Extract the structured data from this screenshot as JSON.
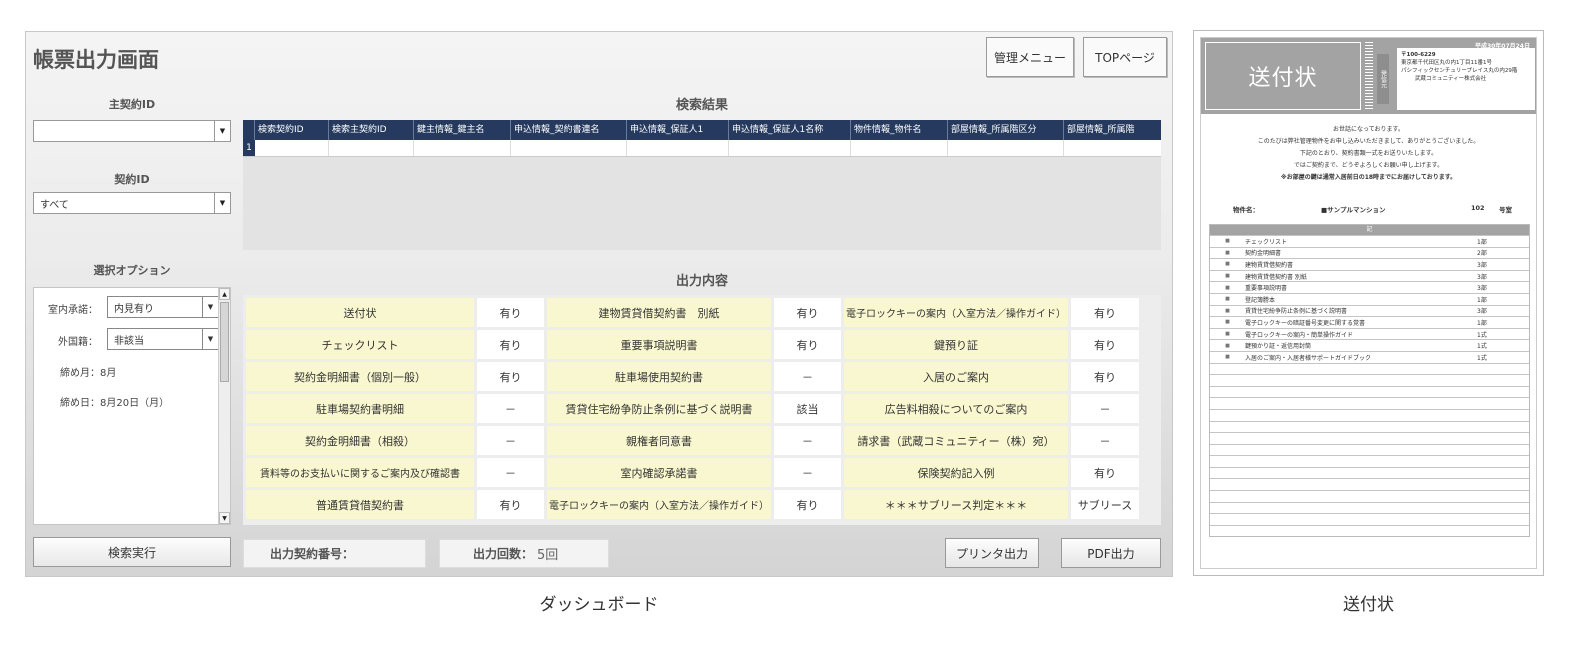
{
  "dashboard": {
    "title": "帳票出力画面",
    "admin_button": "管理メニュー",
    "top_button": "TOPページ",
    "main_contract_label": "主契約ID",
    "main_contract_value": "",
    "contract_label": "契約ID",
    "contract_value": "すべて",
    "options_label": "選択オプション",
    "options": {
      "indoor_label": "室内承諾：",
      "indoor_value": "内見有り",
      "foreign_label": "外国籍：",
      "foreign_value": "非該当",
      "deadline_month": "締め月：8月",
      "deadline_day": "締め日：8月20日（月）"
    },
    "search_button": "検索実行",
    "results_title": "検索結果",
    "results_columns": [
      "検索契約ID",
      "検索主契約ID",
      "鍵主情報_鍵主名",
      "申込情報_契約書連名",
      "申込情報_保証人1",
      "申込情報_保証人1名称",
      "物件情報_物件名",
      "部屋情報_所属階区分",
      "部屋情報_所属階"
    ],
    "results_row_number": "1",
    "output_title": "出力内容",
    "output_items": [
      {
        "name": "送付状",
        "value": "有り"
      },
      {
        "name": "建物賃貸借契約書　別紙",
        "value": "有り"
      },
      {
        "name": "電子ロックキーの案内（入室方法／操作ガイド）",
        "value": "有り"
      },
      {
        "name": "チェックリスト",
        "value": "有り"
      },
      {
        "name": "重要事項説明書",
        "value": "有り"
      },
      {
        "name": "鍵預り証",
        "value": "有り"
      },
      {
        "name": "契約金明細書（個別一般）",
        "value": "有り"
      },
      {
        "name": "駐車場使用契約書",
        "value": "－"
      },
      {
        "name": "入居のご案内",
        "value": "有り"
      },
      {
        "name": "駐車場契約書明細",
        "value": "－"
      },
      {
        "name": "賃貸住宅紛争防止条例に基づく説明書",
        "value": "該当"
      },
      {
        "name": "広告料相殺についてのご案内",
        "value": "－"
      },
      {
        "name": "契約金明細書（相殺）",
        "value": "－"
      },
      {
        "name": "親権者同意書",
        "value": "－"
      },
      {
        "name": "請求書（武蔵コミュニティー（株）宛）",
        "value": "－"
      },
      {
        "name": "賃料等のお支払いに関するご案内及び確認書",
        "value": "－"
      },
      {
        "name": "室内確認承諾書",
        "value": "－"
      },
      {
        "name": "保険契約記入例",
        "value": "有り"
      },
      {
        "name": "普通賃貸借契約書",
        "value": "有り"
      },
      {
        "name": "電子ロックキーの案内（入室方法／操作ガイド）",
        "value": "有り"
      },
      {
        "name": "＊＊＊サブリース判定＊＊＊",
        "value": "サブリース"
      }
    ],
    "output_number_label": "出力契約番号：",
    "output_count_label": "出力回数：",
    "output_count_value": "5回",
    "print_button": "プリンタ出力",
    "pdf_button": "PDF出力"
  },
  "document": {
    "date": "平成30年07月24日",
    "title": "送付状",
    "sender_label": "発信元",
    "zip": "〒100-6229",
    "address_line1": "東京都千代田区丸の内1丁目11番1号",
    "address_line2": "パシフィックセンチュリープレイス丸の内29階",
    "company": "武蔵コミュニティー株式会社",
    "greeting": [
      "お世話になっております。",
      "このたびは弊社管理物件をお申し込みいただきまして、ありがとうございました。",
      "下記のとおり、契約書類一式をお送りいたします。",
      "ではご契約まで、どうぞよろしくお願い申し上げます。"
    ],
    "notice": "※お部屋の鍵は通常入居前日の18時までにお届けしております。",
    "property_label": "物件名：",
    "property_name": "■サンプルマンション",
    "room_number": "102",
    "room_suffix": "号室",
    "list_header": "記",
    "items": [
      {
        "name": "チェックリスト",
        "qty": "1部"
      },
      {
        "name": "契約金明細書",
        "qty": "2部"
      },
      {
        "name": "建物賃貸借契約書",
        "qty": "3部"
      },
      {
        "name": "建物賃貸借契約書 別紙",
        "qty": "3部"
      },
      {
        "name": "重要事項説明書",
        "qty": "3部"
      },
      {
        "name": "登記簿謄本",
        "qty": "1部"
      },
      {
        "name": "賃貸住宅紛争防止条例に基づく説明書",
        "qty": "3部"
      },
      {
        "name": "電子ロックキーの暗証番号変更に関する覚書",
        "qty": "1部"
      },
      {
        "name": "電子ロックキーの案内・簡単操作ガイド",
        "qty": "1式"
      },
      {
        "name": "鍵預かり証・返信用封筒",
        "qty": "1式"
      },
      {
        "name": "入居のご案内・入居者様サポートガイドブック",
        "qty": "1式"
      }
    ]
  },
  "captions": {
    "dashboard": "ダッシュボード",
    "document": "送付状"
  }
}
